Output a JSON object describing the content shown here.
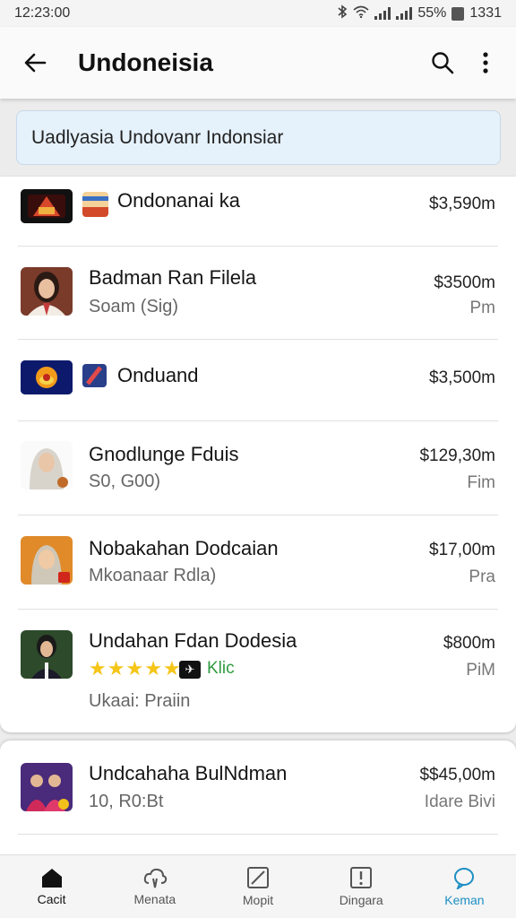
{
  "status": {
    "time": "12:23:00",
    "battery": "55%",
    "right_time": "1331"
  },
  "app_bar": {
    "title": "Undoneisia"
  },
  "banner": {
    "text": "Uadlyasia Undovanr Indonsiar"
  },
  "items": [
    {
      "title": "Ondonanai ka",
      "subtitle": "",
      "price": "$3,590m",
      "unit": ""
    },
    {
      "title": "Badman Ran Filela",
      "subtitle": "Soam (Sig)",
      "price": "$3500m",
      "unit": "Pm"
    },
    {
      "title": "Onduand",
      "subtitle": "",
      "price": "$3,500m",
      "unit": ""
    },
    {
      "title": "Gnodlunge Fduis",
      "subtitle": "S0, G00)",
      "price": "$129,30m",
      "unit": "Fim"
    },
    {
      "title": "Nobakahan Dodcaian",
      "subtitle": "Mkoanaar Rdla)",
      "price": "$17,00m",
      "unit": "Pra"
    },
    {
      "title": "Undahan Fdan Dodesia",
      "subtitle": "Ukaai: Praiin",
      "price": "$800m",
      "unit": "PiM",
      "rating_stars": 5,
      "badge_text": "Klic"
    },
    {
      "title": "Undcahaha BulNdman",
      "subtitle": "10, R0:Bt",
      "price": "$$45,00m",
      "unit": "Idare Bivi"
    }
  ],
  "nav": [
    {
      "label": "Cacit",
      "icon": "home-icon"
    },
    {
      "label": "Menata",
      "icon": "cloud-icon"
    },
    {
      "label": "Mopit",
      "icon": "edit-square-icon"
    },
    {
      "label": "Dingara",
      "icon": "alert-box-icon"
    },
    {
      "label": "Keman",
      "icon": "chat-icon"
    }
  ],
  "colors": {
    "accent": "#1e8fc4",
    "star": "#f5c518",
    "badge_green": "#2e9b3f",
    "banner_bg": "#e5f1fb"
  }
}
